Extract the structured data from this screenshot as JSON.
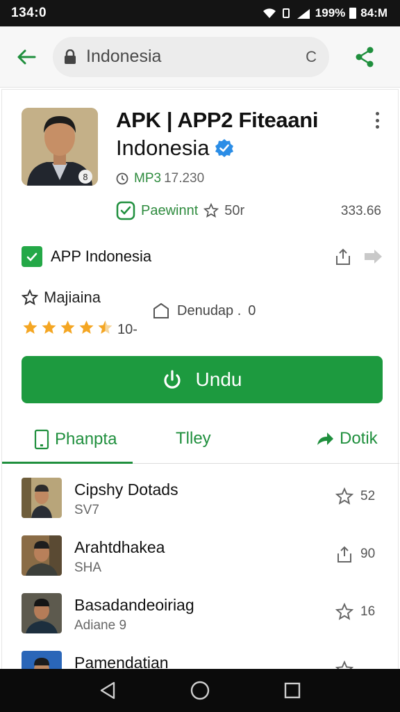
{
  "status_bar": {
    "time": "134:0",
    "battery_percent": "199%",
    "clock_right": "84:M"
  },
  "browser": {
    "url": "Indonesia",
    "reload_label": "C"
  },
  "app": {
    "title_line1": "APK | APP2 Fiteaani",
    "title_line2": "Indonesia",
    "version_code": "MP3",
    "version_number": "17.230",
    "price_label": "Paewinnt",
    "rating_count": "50r",
    "size": "333.66",
    "developer": "APP Indonesia",
    "category": "Majiaina",
    "rating_stars": 4.5,
    "rating_total": "10-",
    "downloads_label": "Denudap .",
    "downloads_value": "0",
    "install_label": "Undu"
  },
  "tabs": [
    {
      "label": "Phanpta"
    },
    {
      "label": "Tlley"
    },
    {
      "label": "Dotik"
    }
  ],
  "list": [
    {
      "name": "Cipshy Dotads",
      "sub": "SV7",
      "action_icon": "star-icon",
      "action_value": "52"
    },
    {
      "name": "Arahtdhakea",
      "sub": "SHA",
      "action_icon": "thumbs-up-icon",
      "action_value": "90"
    },
    {
      "name": "Basadandeoiriag",
      "sub": "Adiane 9",
      "action_icon": "star-icon",
      "action_value": "16"
    },
    {
      "name": "Pamendatian",
      "sub": "",
      "action_icon": "star-icon",
      "action_value": "..."
    }
  ],
  "colors": {
    "accent_green": "#1d9a3f",
    "status_bar": "#141414",
    "verified_blue": "#2b8de6",
    "star_gold": "#f4a623"
  }
}
